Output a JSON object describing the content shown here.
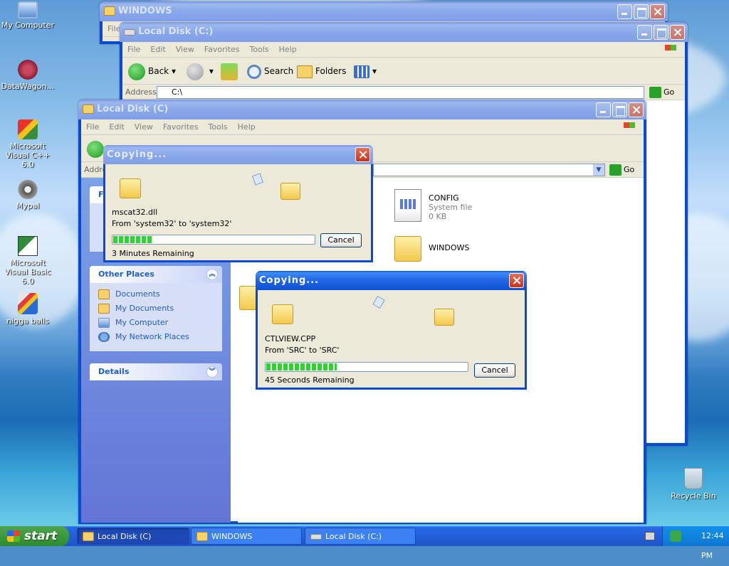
{
  "desktop": {
    "icons": [
      {
        "label": "My Computer",
        "icon": "my-computer-icon"
      },
      {
        "label": "DataWagon…",
        "icon": "datawagon-shortcut-icon"
      },
      {
        "label": "Microsoft Visual C++ 6.0",
        "icon": "visual-cpp-icon"
      },
      {
        "label": "Mypal",
        "icon": "mypal-raccoon-icon"
      },
      {
        "label": "Microsoft Visual Basic 6.0",
        "icon": "visual-basic-icon"
      },
      {
        "label": "nigga balls",
        "icon": "paint-brush-icon"
      },
      {
        "label": "Recycle Bin",
        "icon": "recycle-bin-icon"
      }
    ]
  },
  "windows_window": {
    "title": "WINDOWS",
    "menu_first": "File",
    "address_label": "Addr"
  },
  "localdisk_back": {
    "title": "Local Disk (C:)",
    "menu": [
      "File",
      "Edit",
      "View",
      "Favorites",
      "Tools",
      "Help"
    ],
    "toolbar": {
      "back": "Back",
      "search": "Search",
      "folders": "Folders"
    },
    "address_label": "Address",
    "address_value": "C:\\",
    "go": "Go"
  },
  "localdisk_front": {
    "title": "Local Disk (C)",
    "menu": [
      "File",
      "Edit",
      "View",
      "Favorites",
      "Tools",
      "Help"
    ],
    "address_label": "Addre",
    "go": "Go",
    "tasks_header_initial": "F",
    "other_places": {
      "header": "Other Places",
      "items": [
        "Documents",
        "My Documents",
        "My Computer",
        "My Network Places"
      ]
    },
    "details": {
      "header": "Details"
    },
    "files": [
      {
        "name": "CONFIG",
        "type": "System file",
        "size": "0 KB"
      },
      {
        "name": "WINDOWS",
        "type": "",
        "size": ""
      }
    ]
  },
  "copy1": {
    "title": "Copying...",
    "filename": "mscat32.dll",
    "from": "From 'system32' to 'system32'",
    "remaining": "3 Minutes Remaining",
    "progress": 0.2,
    "cancel": "Cancel"
  },
  "copy2": {
    "title": "Copying...",
    "filename": "CTLVIEW.CPP",
    "from": "From 'SRC' to 'SRC'",
    "remaining": "45 Seconds Remaining",
    "progress": 0.35,
    "cancel": "Cancel"
  },
  "taskbar": {
    "start": "start",
    "tasks": [
      "Local Disk (C)",
      "WINDOWS",
      "Local Disk (C:)"
    ],
    "clock": "12:44 PM"
  }
}
